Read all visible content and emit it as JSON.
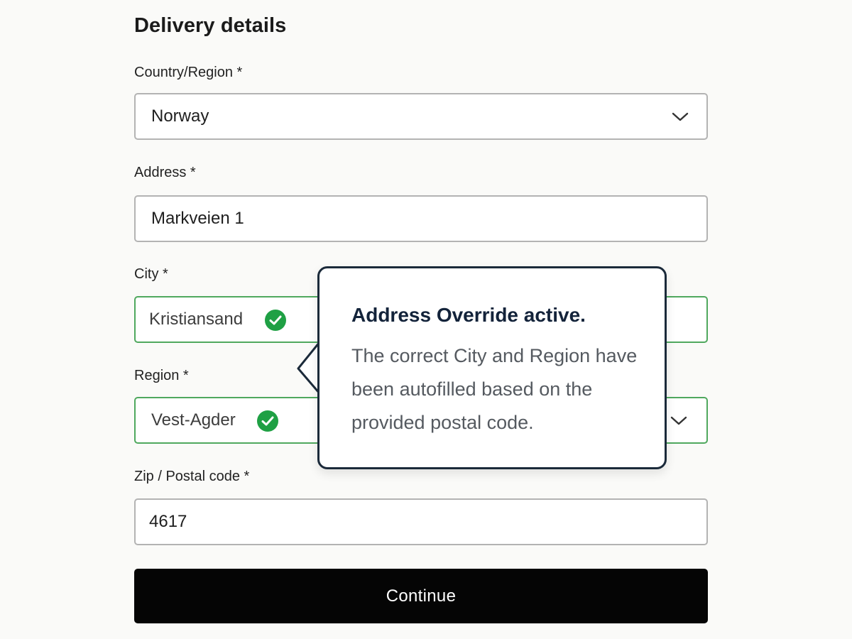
{
  "form": {
    "title": "Delivery details",
    "country": {
      "label": "Country/Region *",
      "value": "Norway"
    },
    "address": {
      "label": "Address *",
      "value": "Markveien 1"
    },
    "city": {
      "label": "City *",
      "value": "Kristiansand"
    },
    "region": {
      "label": "Region *",
      "value": "Vest-Agder"
    },
    "zip": {
      "label": "Zip / Postal code *",
      "value": "4617"
    },
    "continue_label": "Continue"
  },
  "popover": {
    "title": "Address Override active.",
    "body": "The correct City and Region have been autofilled based on the provided postal code."
  },
  "icons": {
    "dropdown": "chevron-down-icon",
    "valid": "check-circle-icon"
  },
  "colors": {
    "valid_border": "#4fa85e",
    "check_fill": "#1fa044",
    "button_bg": "#050505",
    "popover_border": "#1b2a3a"
  }
}
